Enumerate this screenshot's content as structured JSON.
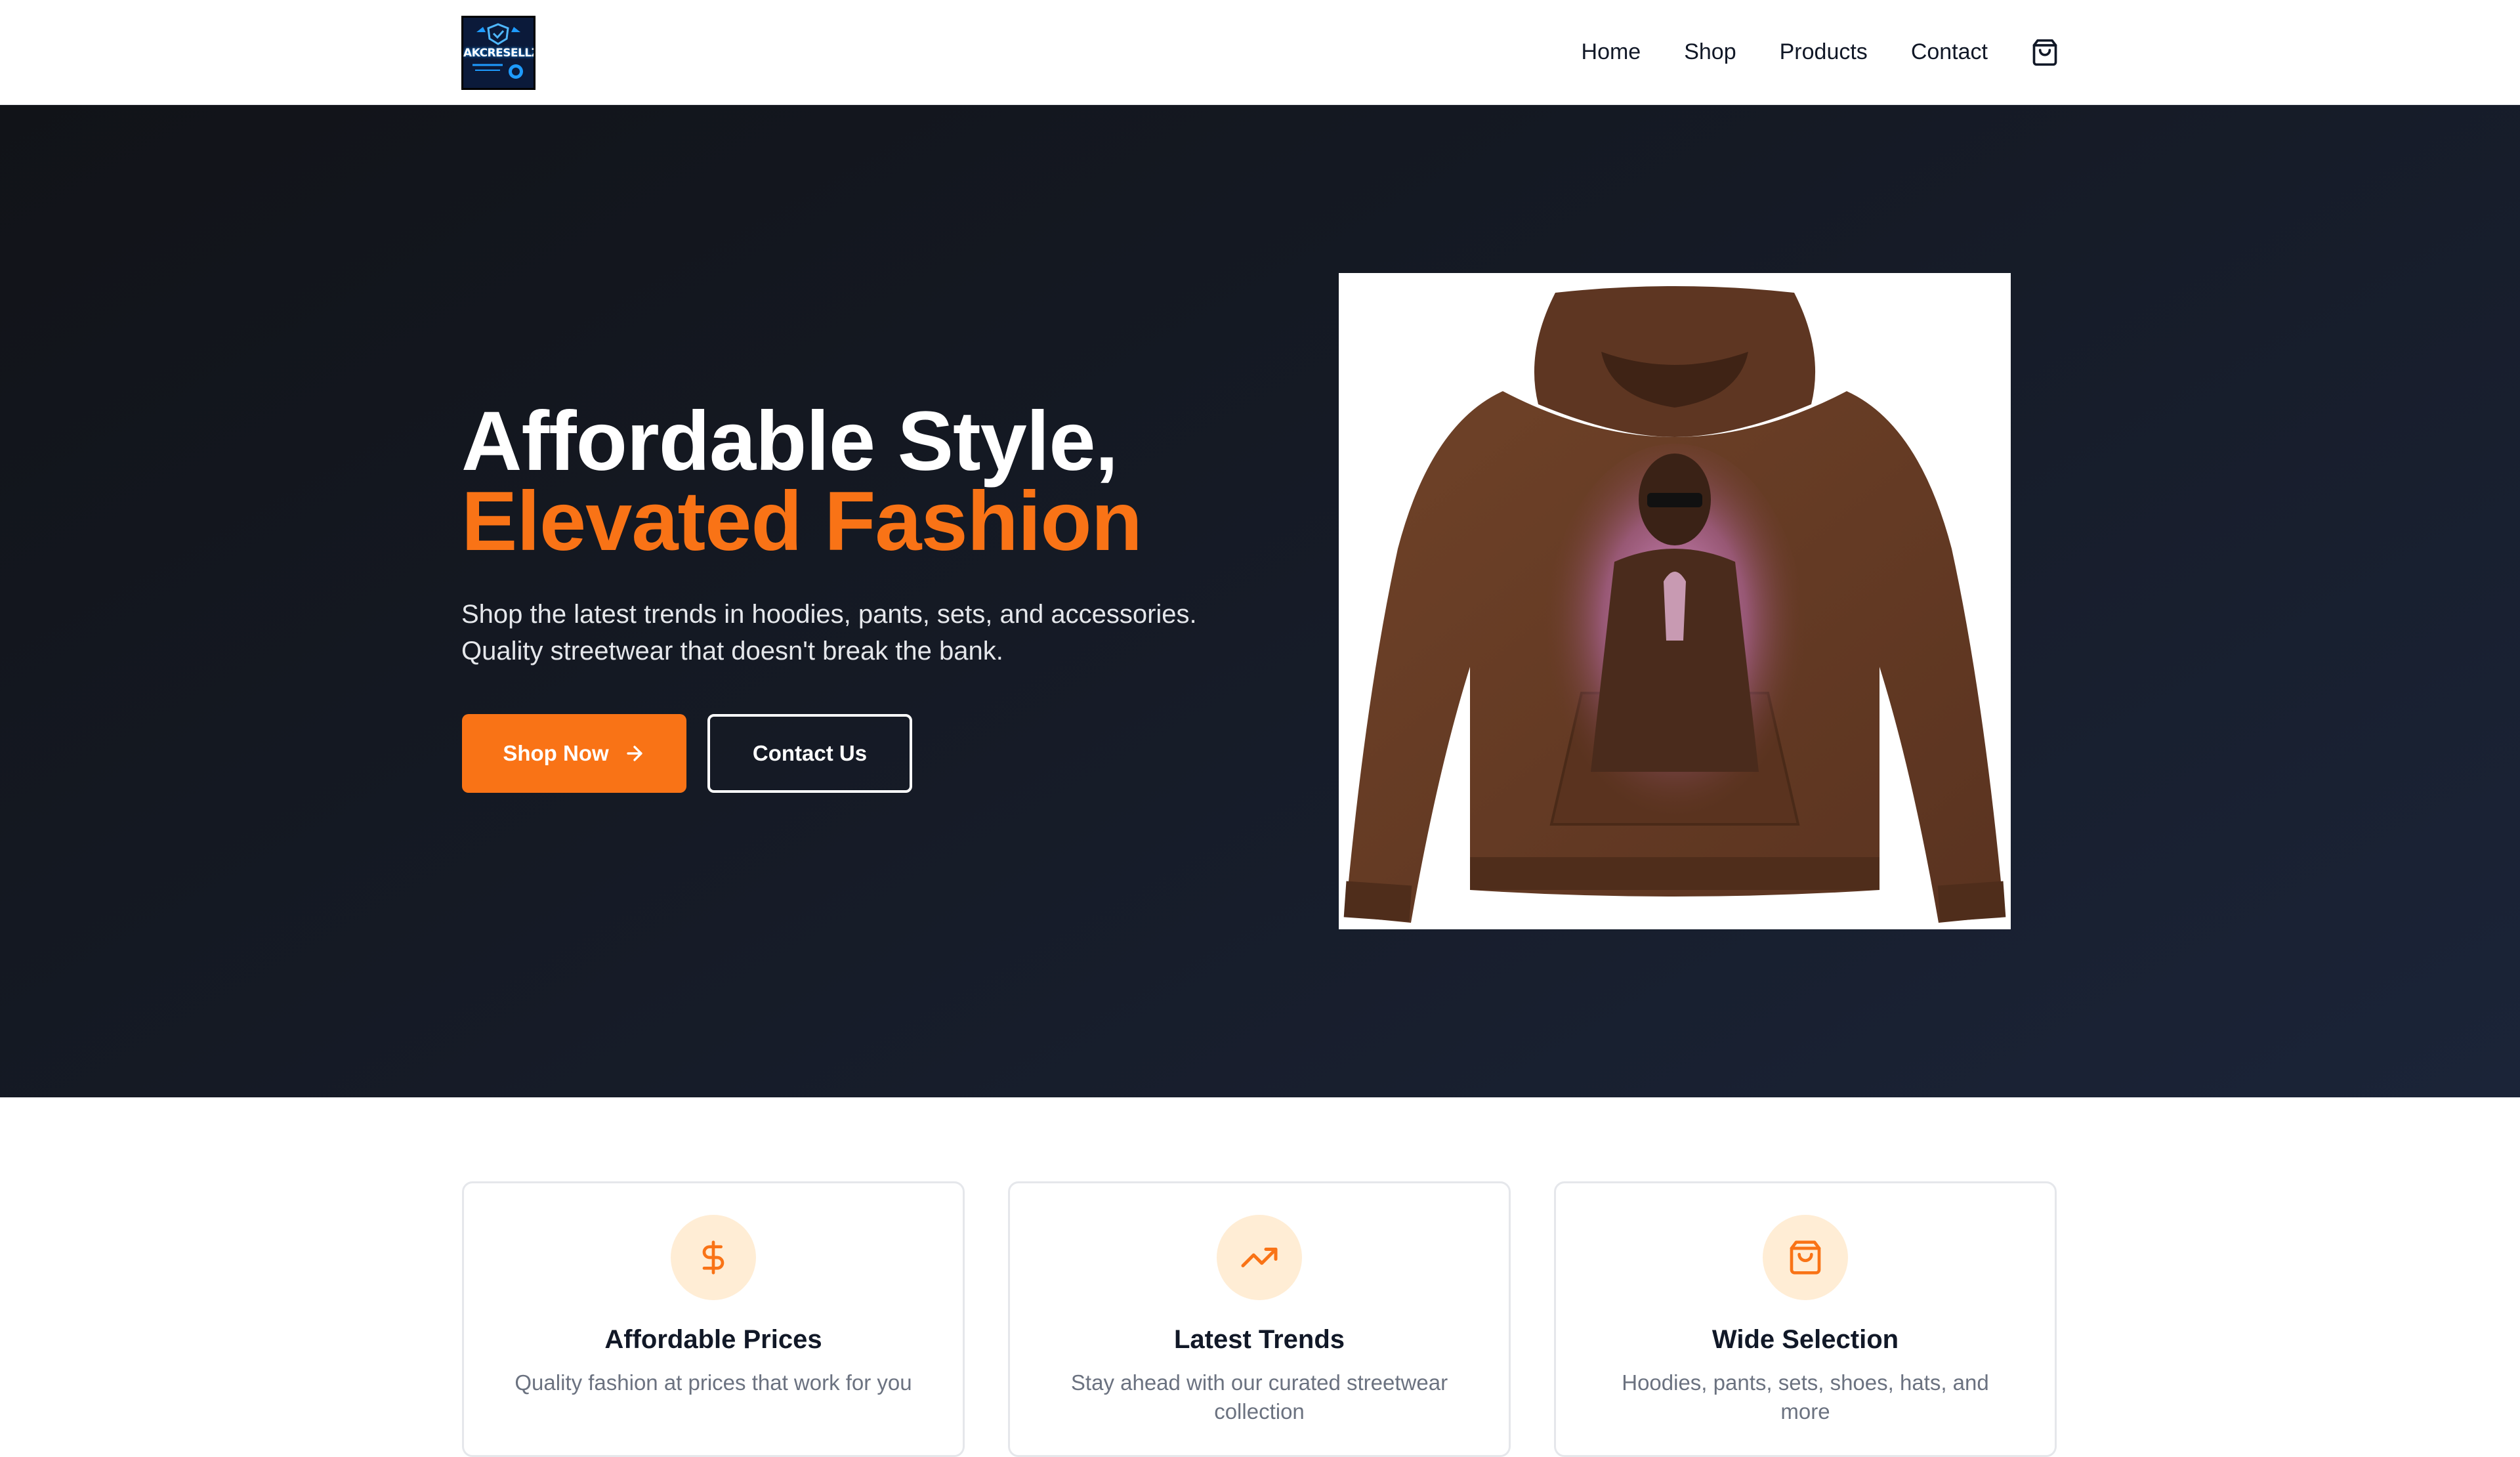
{
  "header": {
    "logo_text": "AKCRESELLZ",
    "nav": {
      "home": "Home",
      "shop": "Shop",
      "products": "Products",
      "contact": "Contact"
    },
    "cart_icon": "shopping-bag-icon"
  },
  "hero": {
    "title_line1": "Affordable Style,",
    "title_line2": "Elevated Fashion",
    "subtitle": "Shop the latest trends in hoodies, pants, sets, and accessories. Quality streetwear that doesn't break the bank.",
    "primary_button": "Shop Now",
    "primary_button_icon": "arrow-right-icon",
    "secondary_button": "Contact Us",
    "image_alt": "brown hoodie with pink graphic"
  },
  "features": [
    {
      "icon": "dollar-icon",
      "title": "Affordable Prices",
      "text": "Quality fashion at prices that work for you"
    },
    {
      "icon": "trending-up-icon",
      "title": "Latest Trends",
      "text": "Stay ahead with our curated streetwear collection"
    },
    {
      "icon": "shopping-bag-icon",
      "title": "Wide Selection",
      "text": "Hoodies, pants, sets, shoes, hats, and more"
    }
  ],
  "colors": {
    "accent": "#f97316",
    "hero_bg": "#151a25",
    "icon_bg": "#ffedd5",
    "muted_text": "#6b7280"
  }
}
